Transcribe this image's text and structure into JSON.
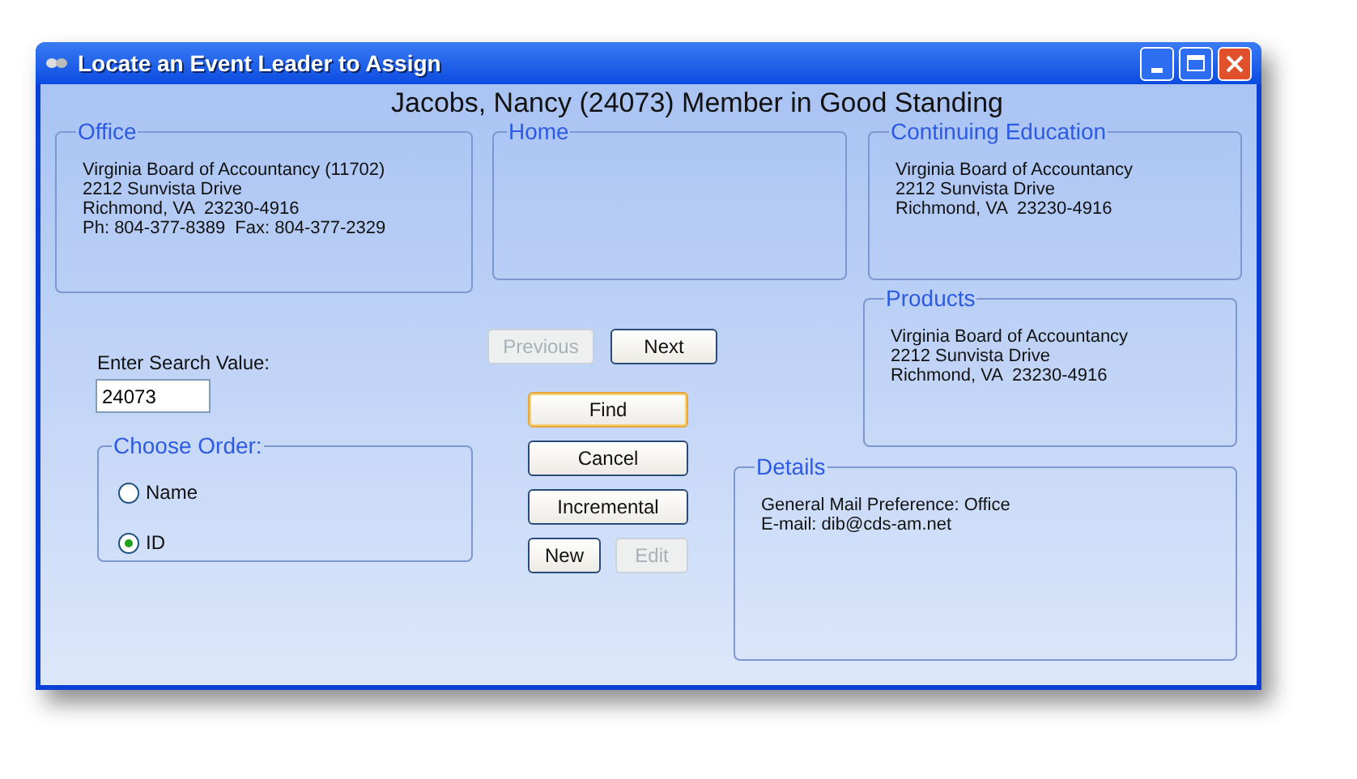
{
  "window": {
    "title": "Locate an Event Leader to Assign"
  },
  "heading": "Jacobs, Nancy (24073) Member in Good Standing",
  "office": {
    "title": "Office",
    "lines": [
      "Virginia Board of Accountancy (11702)",
      "2212 Sunvista Drive",
      "Richmond, VA  23230-4916",
      "Ph: 804-377-8389  Fax: 804-377-2329"
    ]
  },
  "home": {
    "title": "Home"
  },
  "continuing_education": {
    "title": "Continuing Education",
    "lines": [
      "Virginia Board of Accountancy",
      "2212 Sunvista Drive",
      "Richmond, VA  23230-4916"
    ]
  },
  "products": {
    "title": "Products",
    "lines": [
      "Virginia Board of Accountancy",
      "2212 Sunvista Drive",
      "Richmond, VA  23230-4916"
    ]
  },
  "details": {
    "title": "Details",
    "lines": [
      "General Mail Preference: Office",
      "E-mail: dib@cds-am.net"
    ]
  },
  "search": {
    "label": "Enter Search Value:",
    "value": "24073"
  },
  "choose_order": {
    "title": "Choose Order:",
    "options": [
      {
        "label": "Name",
        "selected": false
      },
      {
        "label": "ID",
        "selected": true
      }
    ]
  },
  "nav_buttons": [
    {
      "label": "Previous",
      "disabled": true,
      "focused": false
    },
    {
      "label": "Next",
      "disabled": false,
      "focused": false
    }
  ],
  "action_buttons": [
    {
      "label": "Find",
      "disabled": false,
      "focused": true
    },
    {
      "label": "Cancel",
      "disabled": false,
      "focused": false
    },
    {
      "label": "Incremental",
      "disabled": false,
      "focused": false
    }
  ],
  "edit_buttons": [
    {
      "label": "New",
      "disabled": false,
      "focused": false
    },
    {
      "label": "Edit",
      "disabled": true,
      "focused": false
    }
  ]
}
